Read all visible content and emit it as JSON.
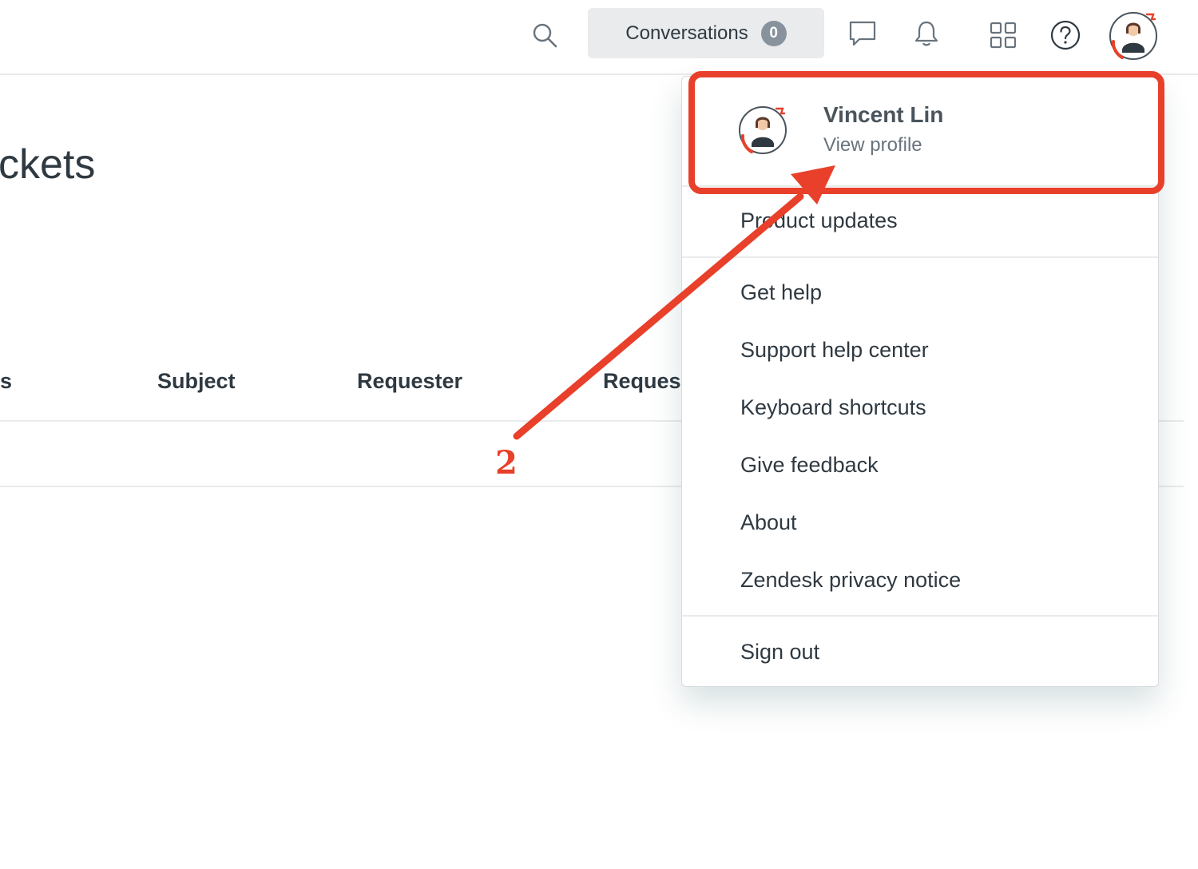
{
  "topbar": {
    "conversations_label": "Conversations",
    "conversations_count": "0",
    "icons": [
      "search-icon",
      "chat-icon",
      "bell-icon",
      "apps-grid-icon",
      "help-icon",
      "user-avatar"
    ]
  },
  "page": {
    "title_fragment": "ckets",
    "columns": [
      "s",
      "Subject",
      "Requester",
      "Reques"
    ]
  },
  "menu": {
    "profile": {
      "name": "Vincent Lin",
      "link": "View profile"
    },
    "items": [
      "Product updates",
      "Get help",
      "Support help center",
      "Keyboard shortcuts",
      "Give feedback",
      "About",
      "Zendesk privacy notice",
      "Sign out"
    ]
  },
  "annotation": {
    "step": "2",
    "color": "#e8402a"
  },
  "colors": {
    "accent_red": "#e8402a",
    "text": "#2f3941",
    "muted": "#68737d",
    "badge": "#87929d",
    "divider": "#e9ebed"
  }
}
